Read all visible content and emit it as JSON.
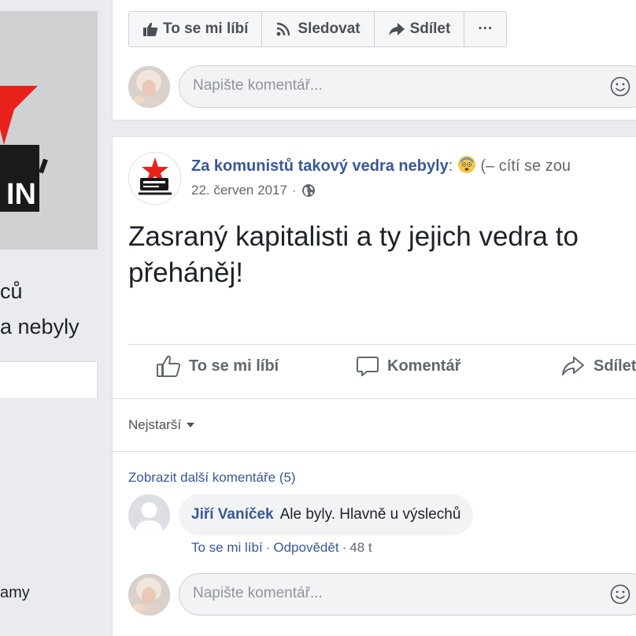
{
  "left": {
    "name_line1": "ců",
    "name_line2": "a nebyly",
    "link": "amy"
  },
  "top_bar": {
    "like_label": "To se mi líbí",
    "follow_label": "Sledovat",
    "share_label": "Sdílet",
    "more_label": "···"
  },
  "composer": {
    "placeholder": "Napište komentář..."
  },
  "post": {
    "author": "Za komunistů takový vedra nebyly",
    "feeling": "(– cítí se zou",
    "date": "22. červen 2017",
    "date_sep": "·",
    "text": "Zasraný kapitalisti a ty jejich vedra to přeháněj!"
  },
  "actions": {
    "like": "To se mi líbí",
    "comment": "Komentář",
    "share": "Sdílet"
  },
  "comments": {
    "sort_label": "Nejstarší",
    "more_label": "Zobrazit další komentáře (5)",
    "items": [
      {
        "author": "Jiří Vaníček",
        "text": "Ale byly. Hlavně u výslechů",
        "like": "To se mi líbí",
        "sep1": "·",
        "reply": "Odpovědět",
        "sep2": "·",
        "age": "48 t"
      }
    ]
  },
  "colors": {
    "link_blue": "#385898",
    "page_bg": "#e9ebee",
    "star_red": "#e8221b"
  }
}
